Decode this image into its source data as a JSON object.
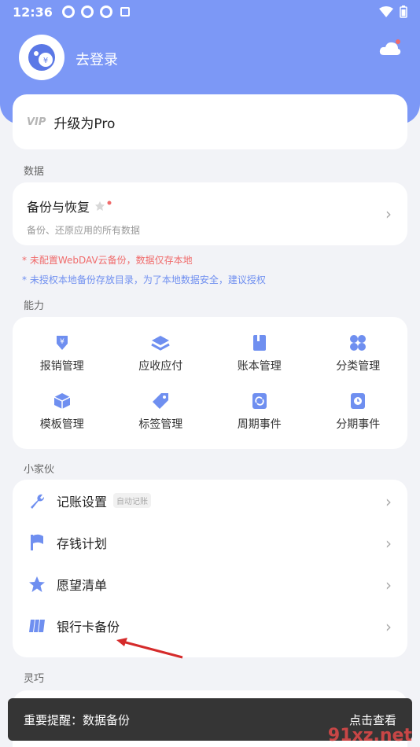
{
  "status_bar": {
    "time": "12:36"
  },
  "header": {
    "login_text": "去登录"
  },
  "pro": {
    "badge": "VIP",
    "label": "升级为Pro"
  },
  "sections": {
    "data": "数据",
    "abilities": "能力",
    "tools": "小家伙",
    "smart": "灵巧"
  },
  "backup": {
    "title": "备份与恢复",
    "subtitle": "备份、还原应用的所有数据"
  },
  "notes": [
    "* 未配置WebDAV云备份，数据仅存本地",
    "* 未授权本地备份存放目录，为了本地数据安全，建议授权"
  ],
  "features": [
    {
      "label": "报销管理",
      "icon": "reimburse-icon"
    },
    {
      "label": "应收应付",
      "icon": "layers-icon"
    },
    {
      "label": "账本管理",
      "icon": "book-icon"
    },
    {
      "label": "分类管理",
      "icon": "category-icon"
    },
    {
      "label": "模板管理",
      "icon": "cube-icon"
    },
    {
      "label": "标签管理",
      "icon": "tag-icon"
    },
    {
      "label": "周期事件",
      "icon": "cycle-icon"
    },
    {
      "label": "分期事件",
      "icon": "clock-doc-icon"
    }
  ],
  "tools": [
    {
      "label": "记账设置",
      "tag": "自动记账",
      "icon": "wrench-icon"
    },
    {
      "label": "存钱计划",
      "icon": "flag-icon"
    },
    {
      "label": "愿望清单",
      "icon": "star-icon"
    },
    {
      "label": "银行卡备份",
      "icon": "card-icon"
    }
  ],
  "toast": {
    "text": "重要提醒：数据备份",
    "action": "点击查看"
  },
  "watermark": "91xz.net",
  "colors": {
    "accent": "#7c98f6",
    "icon": "#6f8ff0",
    "warn": "#f06b6b"
  }
}
